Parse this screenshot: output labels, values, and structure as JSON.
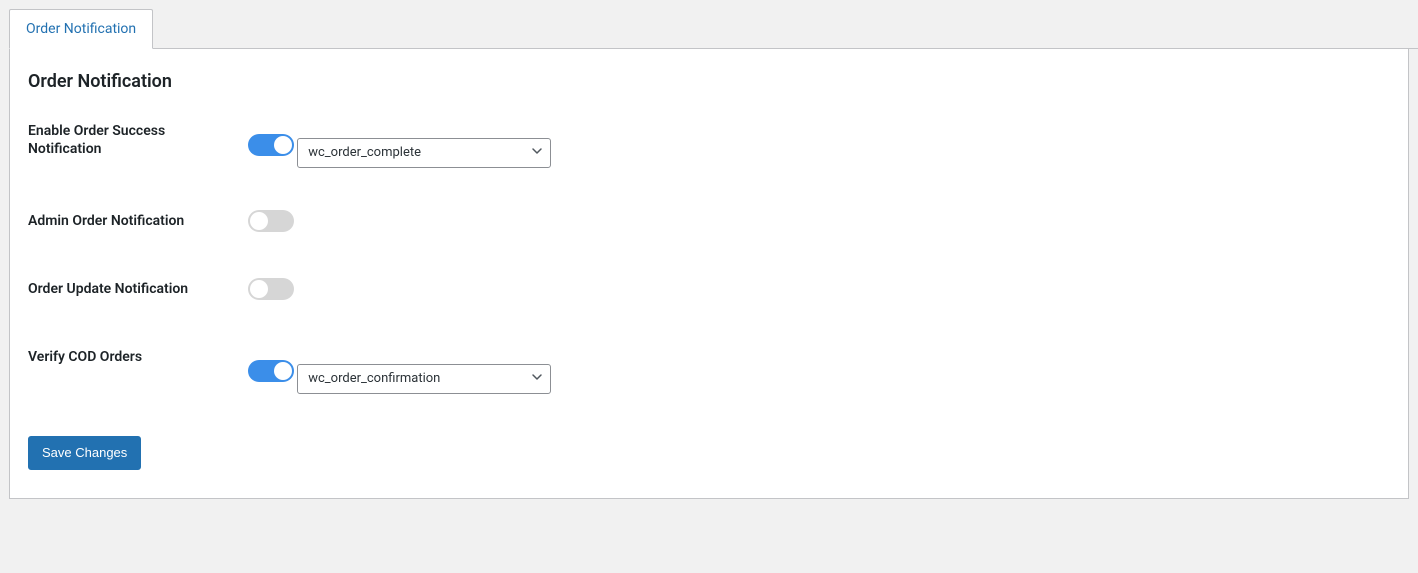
{
  "tab": {
    "label": "Order Notification"
  },
  "panel": {
    "title": "Order Notification"
  },
  "fields": {
    "enable_order_success": {
      "label": "Enable Order Success Notification",
      "toggle": true,
      "select_value": "wc_order_complete"
    },
    "admin_order_notification": {
      "label": "Admin Order Notification",
      "toggle": false
    },
    "order_update_notification": {
      "label": "Order Update Notification",
      "toggle": false
    },
    "verify_cod_orders": {
      "label": "Verify COD Orders",
      "toggle": true,
      "select_value": "wc_order_confirmation"
    }
  },
  "actions": {
    "save_label": "Save Changes"
  }
}
